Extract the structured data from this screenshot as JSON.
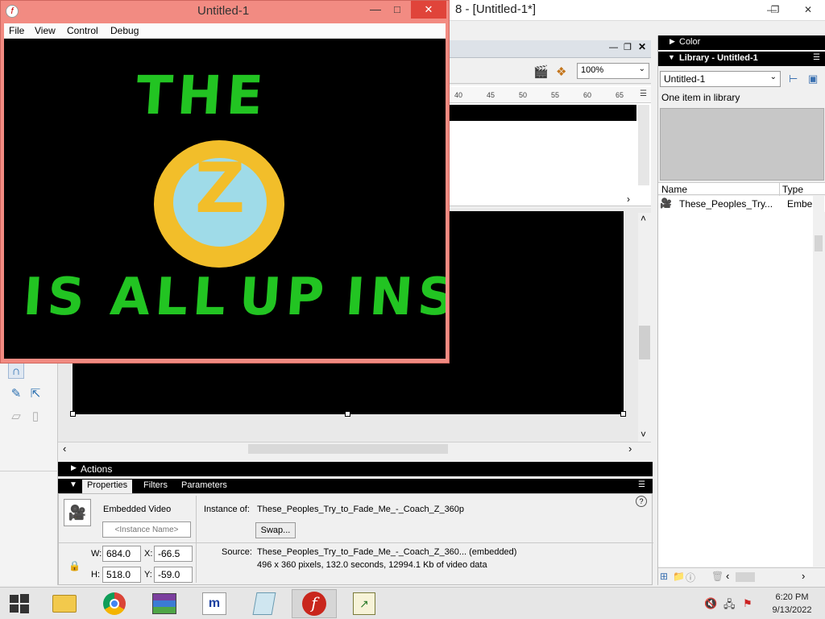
{
  "ide": {
    "title_fragment": "8 - [Untitled-1*]",
    "zoom": "100%",
    "ruler_ticks": [
      "40",
      "45",
      "50",
      "55",
      "60",
      "65"
    ]
  },
  "player": {
    "title": "Untitled-1",
    "menu": [
      "File",
      "View",
      "Control",
      "Debug"
    ],
    "video_text": {
      "line1": "THE",
      "logo_letter": "Z",
      "line2_words": [
        "IS",
        "ALL",
        "UP",
        "INS"
      ]
    },
    "colors": {
      "frame": "#f28b82",
      "text": "#22c422",
      "logo_outer": "#f2be2a",
      "logo_inner": "#9fdbe8"
    }
  },
  "actions_panel": {
    "label": "Actions"
  },
  "properties": {
    "tabs": [
      "Properties",
      "Filters",
      "Parameters"
    ],
    "symbol_type": "Embedded Video",
    "instance_name_placeholder": "<Instance Name>",
    "instance_of_label": "Instance of:",
    "instance_of_value": "These_Peoples_Try_to_Fade_Me_-_Coach_Z_360p",
    "swap_label": "Swap...",
    "w_label": "W:",
    "w_value": "684.0",
    "h_label": "H:",
    "h_value": "518.0",
    "x_label": "X:",
    "x_value": "-66.5",
    "y_label": "Y:",
    "y_value": "-59.0",
    "source_label": "Source:",
    "source_value": "These_Peoples_Try_to_Fade_Me_-_Coach_Z_360... (embedded)",
    "source_details": "496 x 360 pixels, 132.0 seconds, 12994.1 Kb of video data"
  },
  "right_panel": {
    "color_label": "Color",
    "library_label": "Library - Untitled-1",
    "library_select": "Untitled-1",
    "item_count": "One item in library",
    "col_name": "Name",
    "col_type": "Type",
    "item_name": "These_Peoples_Try...",
    "item_type": "Embe"
  },
  "taskbar": {
    "time": "6:20 PM",
    "date": "9/13/2022"
  }
}
